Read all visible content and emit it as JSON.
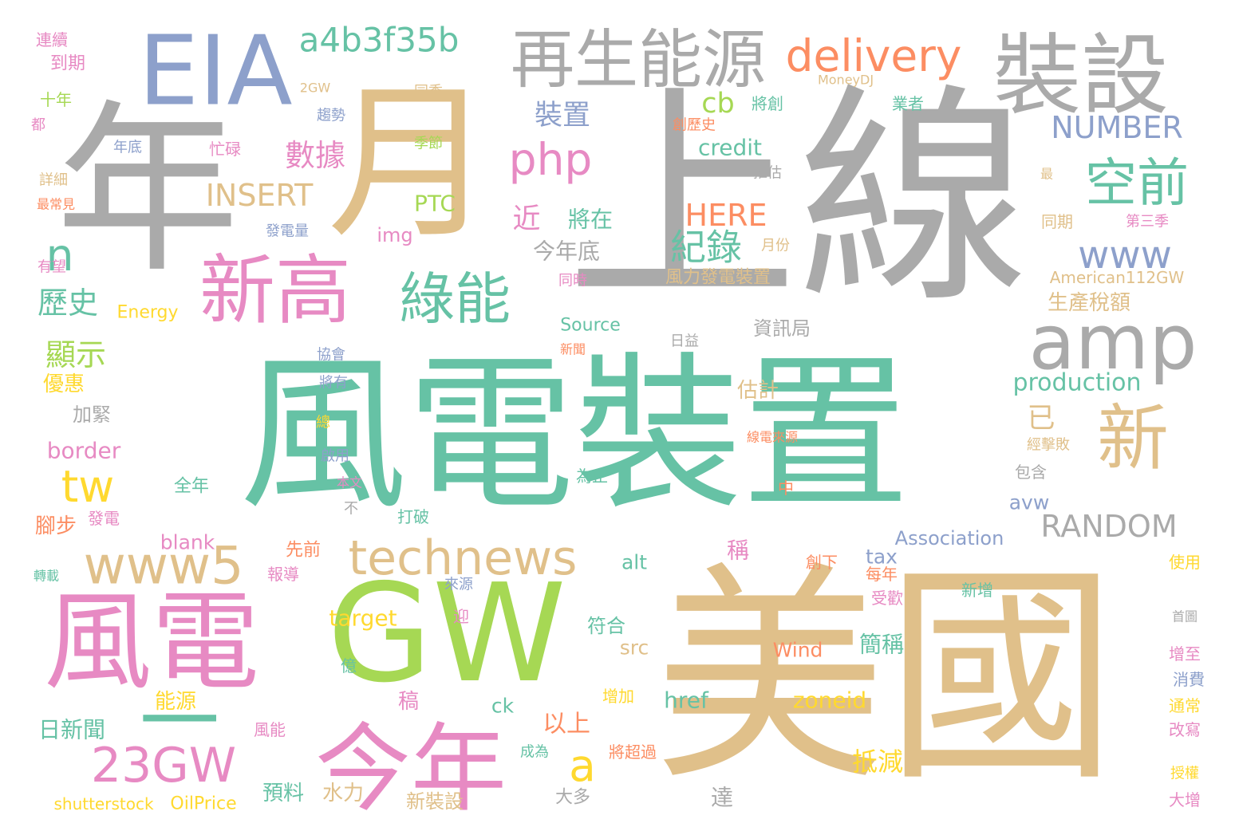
{
  "palette": {
    "gray": "#aaaaaa",
    "teal": "#66c2a5",
    "tan": "#e0c08a",
    "pink": "#e78ac3",
    "blue": "#8da0cb",
    "orange": "#fc8d62",
    "lime": "#a6d854",
    "yellow": "#ffd92f"
  },
  "words": [
    {
      "text": "上線",
      "color": "gray"
    },
    {
      "text": "風電裝置",
      "color": "teal"
    },
    {
      "text": "美國",
      "color": "tan"
    },
    {
      "text": "年",
      "color": "gray"
    },
    {
      "text": "月",
      "color": "tan"
    },
    {
      "text": "EIA",
      "color": "blue"
    },
    {
      "text": "風電",
      "color": "pink"
    },
    {
      "text": "GW",
      "color": "lime"
    },
    {
      "text": "一",
      "color": "teal"
    },
    {
      "text": "今年",
      "color": "pink"
    },
    {
      "text": "裝設",
      "color": "gray"
    },
    {
      "text": "再生能源",
      "color": "gray"
    },
    {
      "text": "新高",
      "color": "pink"
    },
    {
      "text": "新",
      "color": "tan"
    },
    {
      "text": "amp",
      "color": "gray"
    },
    {
      "text": "綠能",
      "color": "teal"
    },
    {
      "text": "delivery",
      "color": "orange"
    },
    {
      "text": "a4b3f35b",
      "color": "teal"
    },
    {
      "text": "technews",
      "color": "tan"
    },
    {
      "text": "www5",
      "color": "tan"
    },
    {
      "text": "23GW",
      "color": "pink"
    },
    {
      "text": "空前",
      "color": "teal"
    },
    {
      "text": "php",
      "color": "pink"
    },
    {
      "text": "www",
      "color": "blue"
    },
    {
      "text": "RANDOM",
      "color": "gray"
    },
    {
      "text": "NUMBER",
      "color": "blue"
    },
    {
      "text": "INSERT",
      "color": "tan"
    },
    {
      "text": "HERE",
      "color": "orange"
    },
    {
      "text": "tw",
      "color": "yellow"
    },
    {
      "text": "n",
      "color": "teal"
    },
    {
      "text": "a",
      "color": "yellow"
    },
    {
      "text": "cb",
      "color": "lime"
    },
    {
      "text": "紀錄",
      "color": "teal"
    },
    {
      "text": "數據",
      "color": "pink"
    },
    {
      "text": "裝置",
      "color": "blue"
    },
    {
      "text": "顯示",
      "color": "lime"
    },
    {
      "text": "歷史",
      "color": "teal"
    },
    {
      "text": "近",
      "color": "pink"
    },
    {
      "text": "將在",
      "color": "teal"
    },
    {
      "text": "今年底",
      "color": "gray"
    },
    {
      "text": "已",
      "color": "tan"
    },
    {
      "text": "production",
      "color": "teal"
    },
    {
      "text": "credit",
      "color": "teal"
    },
    {
      "text": "PTC",
      "color": "lime"
    },
    {
      "text": "img",
      "color": "pink"
    },
    {
      "text": "border",
      "color": "pink"
    },
    {
      "text": "blank",
      "color": "pink"
    },
    {
      "text": "alt",
      "color": "teal"
    },
    {
      "text": "tax",
      "color": "blue"
    },
    {
      "text": "avw",
      "color": "blue"
    },
    {
      "text": "Association",
      "color": "blue"
    },
    {
      "text": "target",
      "color": "yellow"
    },
    {
      "text": "src",
      "color": "tan"
    },
    {
      "text": "href",
      "color": "teal"
    },
    {
      "text": "zoneid",
      "color": "yellow"
    },
    {
      "text": "ck",
      "color": "teal"
    },
    {
      "text": "Wind",
      "color": "orange"
    },
    {
      "text": "Source",
      "color": "teal"
    },
    {
      "text": "Energy",
      "color": "yellow"
    },
    {
      "text": "American112GW",
      "color": "tan"
    },
    {
      "text": "MoneyDJ",
      "color": "tan"
    },
    {
      "text": "2GW",
      "color": "tan"
    },
    {
      "text": "shutterstock",
      "color": "yellow"
    },
    {
      "text": "OilPrice",
      "color": "yellow"
    },
    {
      "text": "生產稅額",
      "color": "tan"
    },
    {
      "text": "風力發電裝置",
      "color": "tan"
    },
    {
      "text": "資訊局",
      "color": "gray"
    },
    {
      "text": "估計",
      "color": "tan"
    },
    {
      "text": "抵減",
      "color": "yellow"
    },
    {
      "text": "預料",
      "color": "teal"
    },
    {
      "text": "水力",
      "color": "tan"
    },
    {
      "text": "新裝設",
      "color": "tan"
    },
    {
      "text": "以上",
      "color": "orange"
    },
    {
      "text": "大多",
      "color": "gray"
    },
    {
      "text": "達",
      "color": "gray"
    },
    {
      "text": "稱",
      "color": "pink"
    },
    {
      "text": "簡稱",
      "color": "teal"
    },
    {
      "text": "符合",
      "color": "teal"
    },
    {
      "text": "日新聞",
      "color": "teal"
    },
    {
      "text": "能源",
      "color": "yellow"
    },
    {
      "text": "稿",
      "color": "pink"
    },
    {
      "text": "優惠",
      "color": "yellow"
    },
    {
      "text": "加緊",
      "color": "gray"
    },
    {
      "text": "腳步",
      "color": "orange"
    },
    {
      "text": "發電",
      "color": "pink"
    },
    {
      "text": "全年",
      "color": "teal"
    },
    {
      "text": "先前",
      "color": "orange"
    },
    {
      "text": "報導",
      "color": "pink"
    },
    {
      "text": "打破",
      "color": "teal"
    },
    {
      "text": "來源",
      "color": "blue"
    },
    {
      "text": "迎",
      "color": "pink"
    },
    {
      "text": "億",
      "color": "teal"
    },
    {
      "text": "增加",
      "color": "yellow"
    },
    {
      "text": "成為",
      "color": "teal"
    },
    {
      "text": "將超過",
      "color": "orange"
    },
    {
      "text": "風能",
      "color": "pink"
    },
    {
      "text": "轉載",
      "color": "teal"
    },
    {
      "text": "有望",
      "color": "pink"
    },
    {
      "text": "連續",
      "color": "pink"
    },
    {
      "text": "到期",
      "color": "pink"
    },
    {
      "text": "十年",
      "color": "lime"
    },
    {
      "text": "都",
      "color": "pink"
    },
    {
      "text": "年底",
      "color": "blue"
    },
    {
      "text": "忙碌",
      "color": "pink"
    },
    {
      "text": "趨勢",
      "color": "blue"
    },
    {
      "text": "同季",
      "color": "tan"
    },
    {
      "text": "季節",
      "color": "lime"
    },
    {
      "text": "詳細",
      "color": "tan"
    },
    {
      "text": "最常見",
      "color": "orange"
    },
    {
      "text": "發電量",
      "color": "blue"
    },
    {
      "text": "協會",
      "color": "blue"
    },
    {
      "text": "將有",
      "color": "blue"
    },
    {
      "text": "總",
      "color": "yellow"
    },
    {
      "text": "啟用",
      "color": "blue"
    },
    {
      "text": "本文",
      "color": "pink"
    },
    {
      "text": "不",
      "color": "gray"
    },
    {
      "text": "為止",
      "color": "teal"
    },
    {
      "text": "中",
      "color": "orange"
    },
    {
      "text": "線電來源",
      "color": "orange"
    },
    {
      "text": "日益",
      "color": "gray"
    },
    {
      "text": "新聞",
      "color": "orange"
    },
    {
      "text": "同時",
      "color": "pink"
    },
    {
      "text": "月份",
      "color": "tan"
    },
    {
      "text": "將創",
      "color": "teal"
    },
    {
      "text": "創歷史",
      "color": "orange"
    },
    {
      "text": "推估",
      "color": "gray"
    },
    {
      "text": "業者",
      "color": "teal"
    },
    {
      "text": "最",
      "color": "tan"
    },
    {
      "text": "同期",
      "color": "tan"
    },
    {
      "text": "第三季",
      "color": "pink"
    },
    {
      "text": "經擊敗",
      "color": "tan"
    },
    {
      "text": "包含",
      "color": "gray"
    },
    {
      "text": "創下",
      "color": "orange"
    },
    {
      "text": "每年",
      "color": "orange"
    },
    {
      "text": "受歡",
      "color": "pink"
    },
    {
      "text": "新增",
      "color": "teal"
    },
    {
      "text": "使用",
      "color": "yellow"
    },
    {
      "text": "首圖",
      "color": "gray"
    },
    {
      "text": "增至",
      "color": "pink"
    },
    {
      "text": "消費",
      "color": "blue"
    },
    {
      "text": "通常",
      "color": "yellow"
    },
    {
      "text": "改寫",
      "color": "pink"
    },
    {
      "text": "授權",
      "color": "yellow"
    },
    {
      "text": "大增",
      "color": "pink"
    }
  ]
}
